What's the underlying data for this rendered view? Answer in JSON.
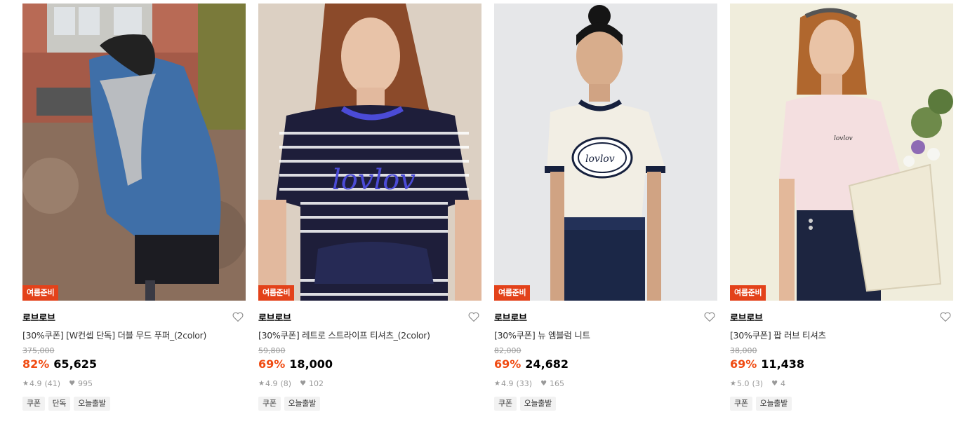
{
  "products": [
    {
      "badge": "여름준비",
      "brand": "로브로브",
      "name": "[30%쿠폰] [W컨셉 단독] 더블 무드 푸퍼_(2color)",
      "original_price": "375,000",
      "discount": "82%",
      "price": "65,625",
      "rating": "4.9",
      "reviews": "(41)",
      "likes": "995",
      "tags": [
        "쿠폰",
        "단독",
        "오늘출발"
      ],
      "image": "woman-in-blue-puffer-jacket-icon"
    },
    {
      "badge": "여름준비",
      "brand": "로브로브",
      "name": "[30%쿠폰] 레트로 스트라이프 티셔츠_(2color)",
      "original_price": "59,800",
      "discount": "69%",
      "price": "18,000",
      "rating": "4.9",
      "reviews": "(8)",
      "likes": "102",
      "tags": [
        "쿠폰",
        "오늘출발"
      ],
      "image": "woman-in-striped-tshirt-icon"
    },
    {
      "badge": "여름준비",
      "brand": "로브로브",
      "name": "[30%쿠폰] 뉴 엠블럼 니트",
      "original_price": "82,000",
      "discount": "69%",
      "price": "24,682",
      "rating": "4.9",
      "reviews": "(33)",
      "likes": "165",
      "tags": [
        "쿠폰",
        "오늘출발"
      ],
      "image": "woman-in-emblem-knit-icon"
    },
    {
      "badge": "여름준비",
      "brand": "로브로브",
      "name": "[30%쿠폰] 팝 러브 티셔츠",
      "original_price": "38,000",
      "discount": "69%",
      "price": "11,438",
      "rating": "5.0",
      "reviews": "(3)",
      "likes": "4",
      "tags": [
        "쿠폰",
        "오늘출발"
      ],
      "image": "woman-in-pink-tshirt-icon"
    }
  ],
  "colors": {
    "badge": "#e3421a",
    "discount": "#f04b12",
    "muted": "#999999",
    "tag_bg": "#f2f2f2"
  }
}
